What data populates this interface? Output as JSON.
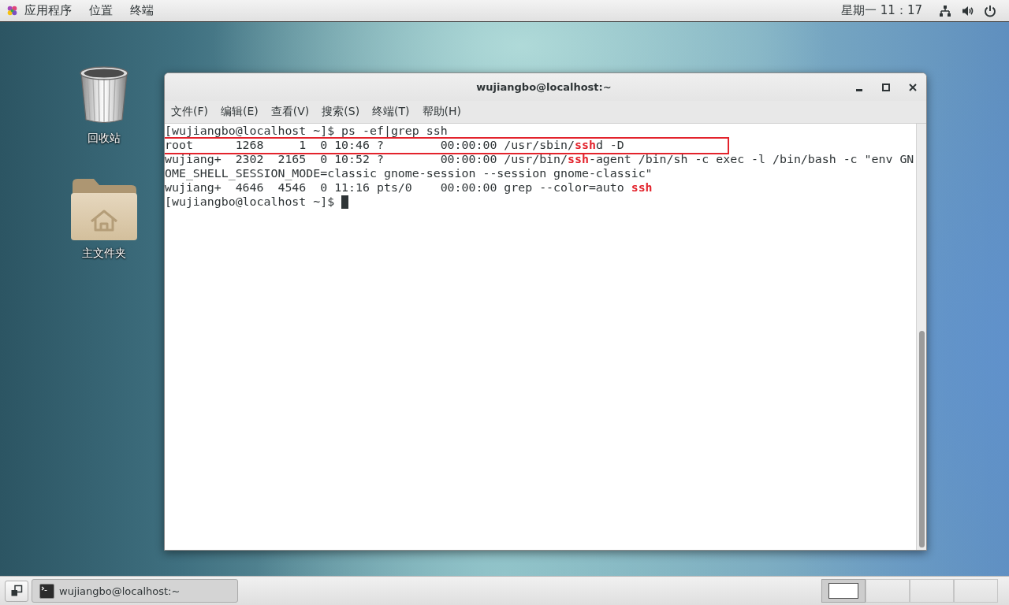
{
  "top_bar": {
    "menus": [
      "应用程序",
      "位置",
      "终端"
    ],
    "clock": "星期一 11：17"
  },
  "desktop_icons": [
    {
      "kind": "trash",
      "label": "回收站"
    },
    {
      "kind": "home_folder",
      "label": "主文件夹"
    }
  ],
  "window": {
    "title": "wujiangbo@localhost:~",
    "menu": [
      "文件(F)",
      "编辑(E)",
      "查看(V)",
      "搜索(S)",
      "终端(T)",
      "帮助(H)"
    ],
    "terminal": {
      "cursor": true,
      "lines": [
        {
          "boxed": false,
          "segments": [
            {
              "text": "[wujiangbo@localhost ~]$ ps -ef|grep ssh",
              "match": false
            }
          ]
        },
        {
          "boxed": true,
          "segments": [
            {
              "text": "root      1268     1  0 10:46 ?        00:00:00 /usr/sbin/",
              "match": false
            },
            {
              "text": "ssh",
              "match": true
            },
            {
              "text": "d -D",
              "match": false
            }
          ]
        },
        {
          "boxed": false,
          "segments": [
            {
              "text": "wujiang+  2302  2165  0 10:52 ?        00:00:00 /usr/bin/",
              "match": false
            },
            {
              "text": "ssh",
              "match": true
            },
            {
              "text": "-agent /bin/sh -c exec -l /bin/bash -c \"env GN",
              "match": false
            }
          ]
        },
        {
          "boxed": false,
          "segments": [
            {
              "text": "OME_SHELL_SESSION_MODE=classic gnome-session --session gnome-classic\"",
              "match": false
            }
          ]
        },
        {
          "boxed": false,
          "segments": [
            {
              "text": "wujiang+  4646  4546  0 11:16 pts/0    00:00:00 grep --color=auto ",
              "match": false
            },
            {
              "text": "ssh",
              "match": true
            }
          ]
        },
        {
          "boxed": false,
          "segments": [
            {
              "text": "[wujiangbo@localhost ~]$ ",
              "match": false
            }
          ]
        }
      ]
    }
  },
  "taskbar": {
    "tasks": [
      {
        "label": "wujiangbo@localhost:~",
        "selected": true
      }
    ],
    "workspaces": [
      {
        "selected": true,
        "has_window": true
      },
      {
        "selected": false,
        "has_window": false
      },
      {
        "selected": false,
        "has_window": false
      },
      {
        "selected": false,
        "has_window": false
      }
    ]
  }
}
